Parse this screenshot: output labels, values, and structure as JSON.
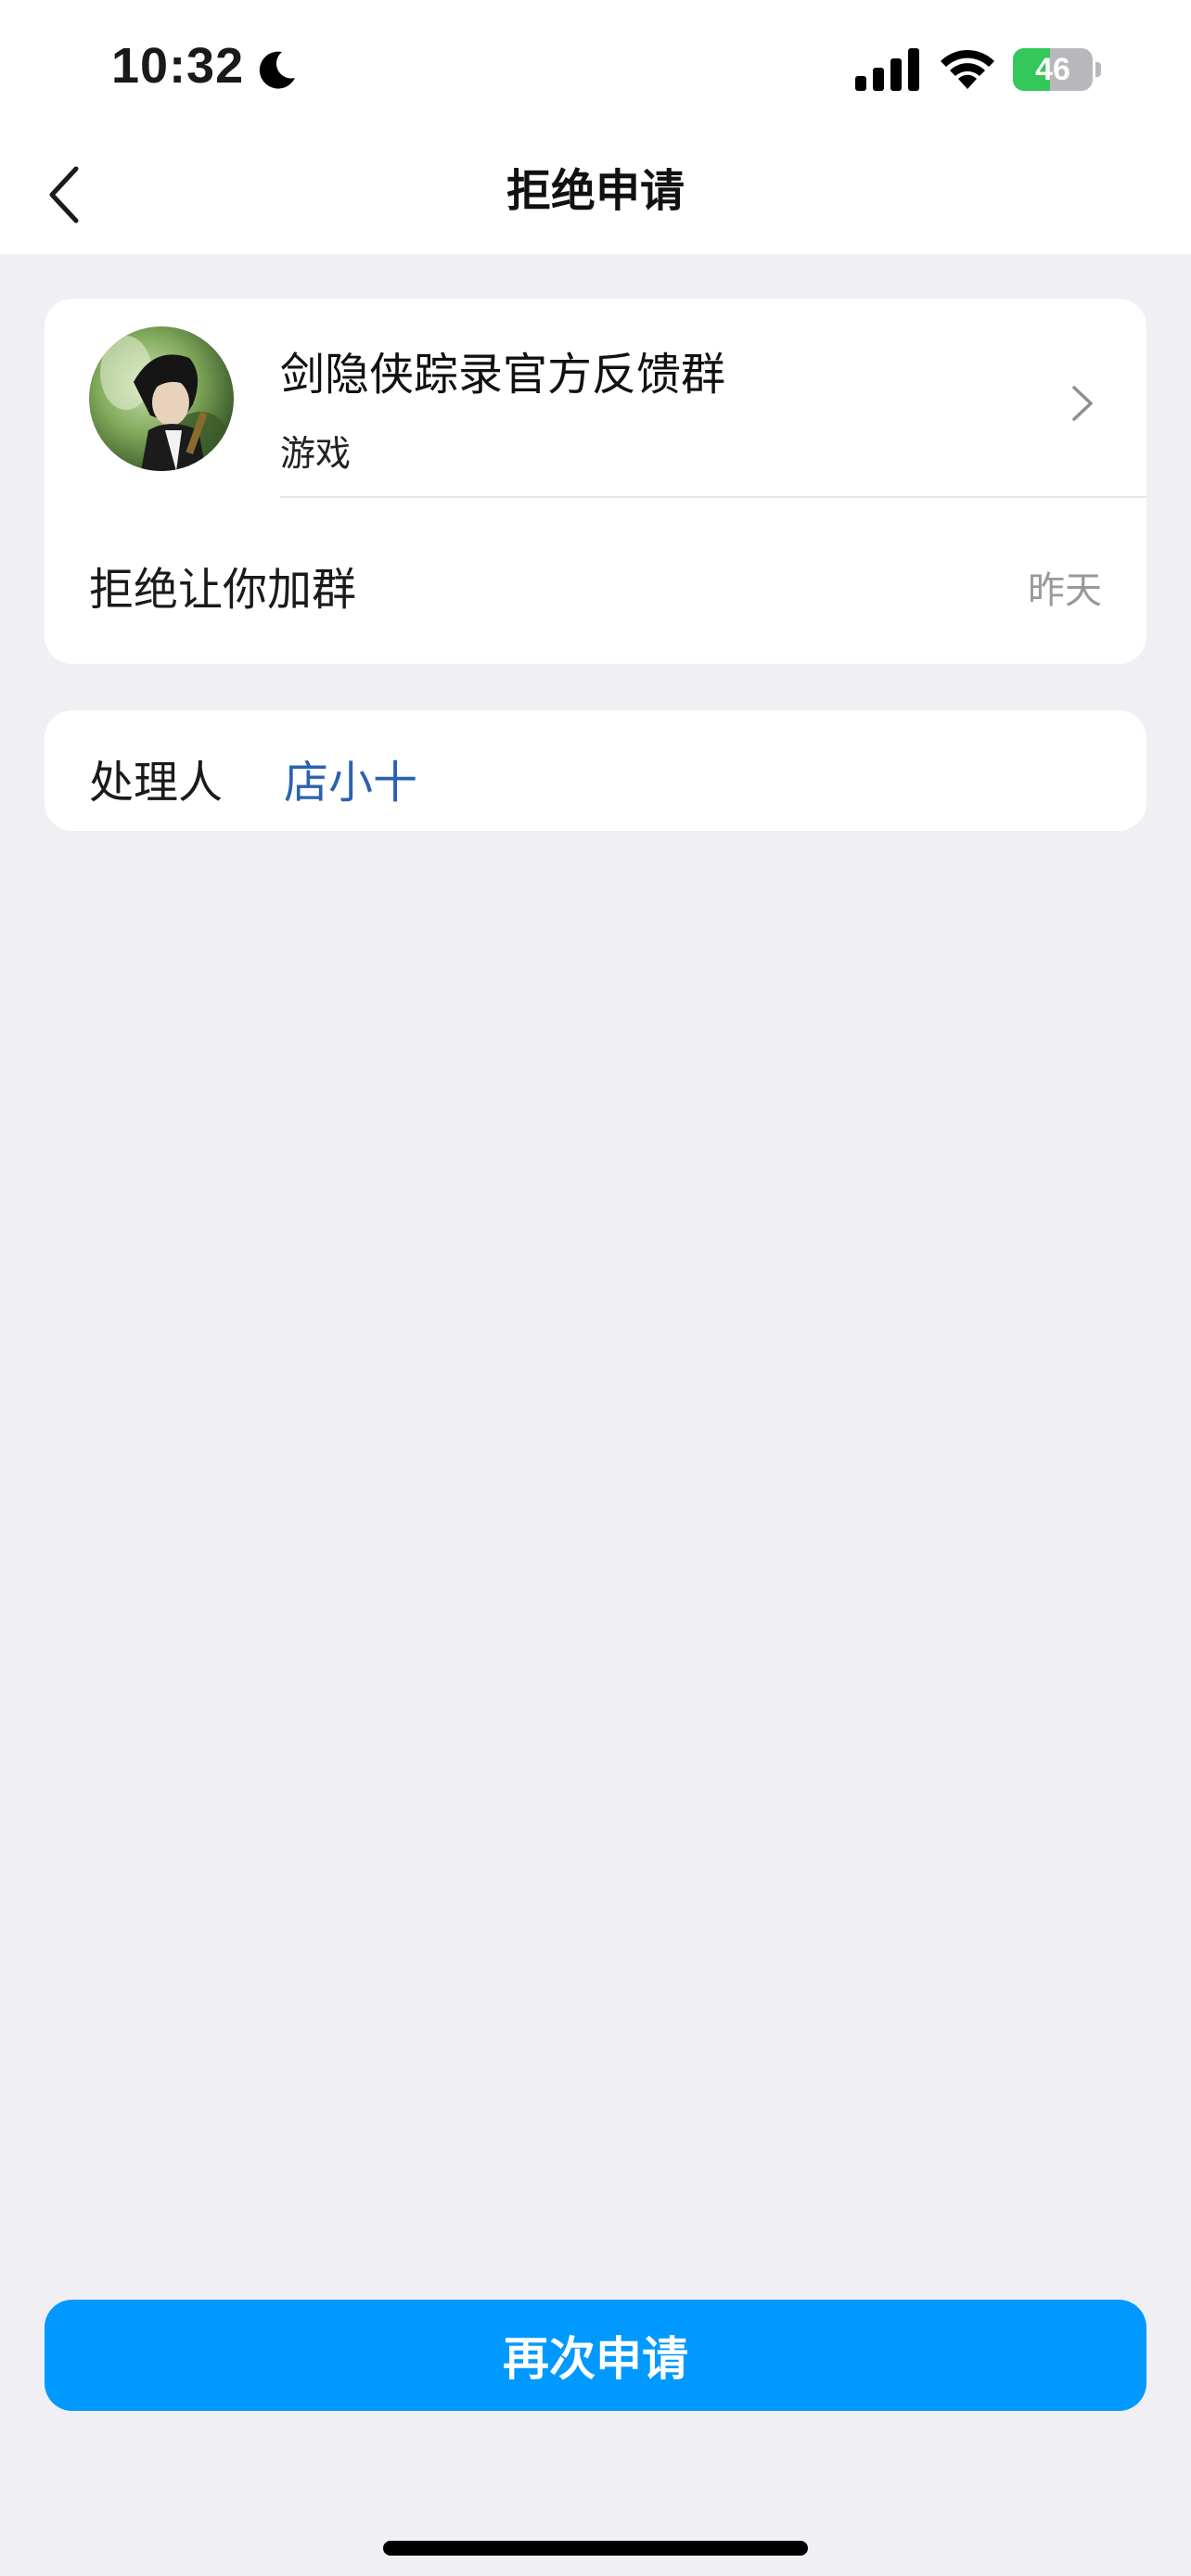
{
  "status_bar": {
    "time": "10:32",
    "battery_level": "46",
    "battery_fraction": 0.46,
    "icons": [
      "moon-icon",
      "signal-icon",
      "wifi-icon",
      "battery-icon"
    ]
  },
  "nav": {
    "title": "拒绝申请",
    "back_icon": "chevron-left-icon"
  },
  "group": {
    "name": "剑隐侠踪录官方反馈群",
    "category": "游戏",
    "chevron_icon": "chevron-right-icon"
  },
  "request": {
    "message": "拒绝让你加群",
    "time": "昨天"
  },
  "handler": {
    "label": "处理人",
    "name": "店小十"
  },
  "actions": {
    "reapply_label": "再次申请"
  },
  "colors": {
    "accent": "#0099ff",
    "link": "#2a62b0",
    "battery_green": "#34c759",
    "background": "#efeff4"
  }
}
